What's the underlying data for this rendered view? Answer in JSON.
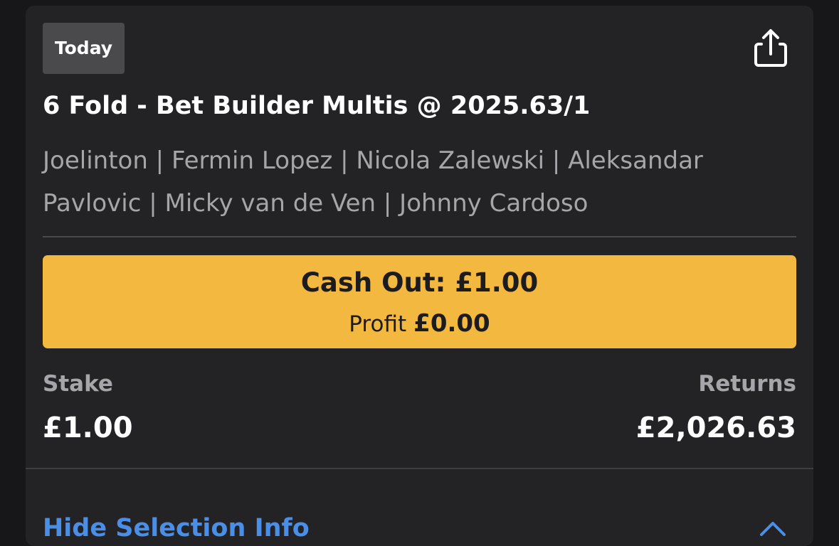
{
  "card": {
    "badge": "Today",
    "share_icon": "share-icon",
    "title": "6 Fold - Bet Builder Multis @ 2025.63/1",
    "selections_line1": "Joelinton | Fermin Lopez | Nicola Zalewski | Aleksandar",
    "selections_line2": "Pavlovic | Micky van de Ven | Johnny Cardoso"
  },
  "cashout": {
    "label": "Cash Out: £1.00",
    "profit_label": "Profit",
    "profit_value": "£0.00"
  },
  "stake": {
    "label": "Stake",
    "value": "£1.00"
  },
  "returns": {
    "label": "Returns",
    "value": "£2,026.63"
  },
  "selection_info": {
    "link_label": "Hide Selection Info",
    "icon": "chevron-up-icon"
  },
  "colors": {
    "background": "#171719",
    "card": "#232325",
    "badge": "#4a4a4d",
    "accent_cashout": "#f3b83f",
    "link": "#4a8ee6",
    "muted_text": "#a6a6aa"
  }
}
